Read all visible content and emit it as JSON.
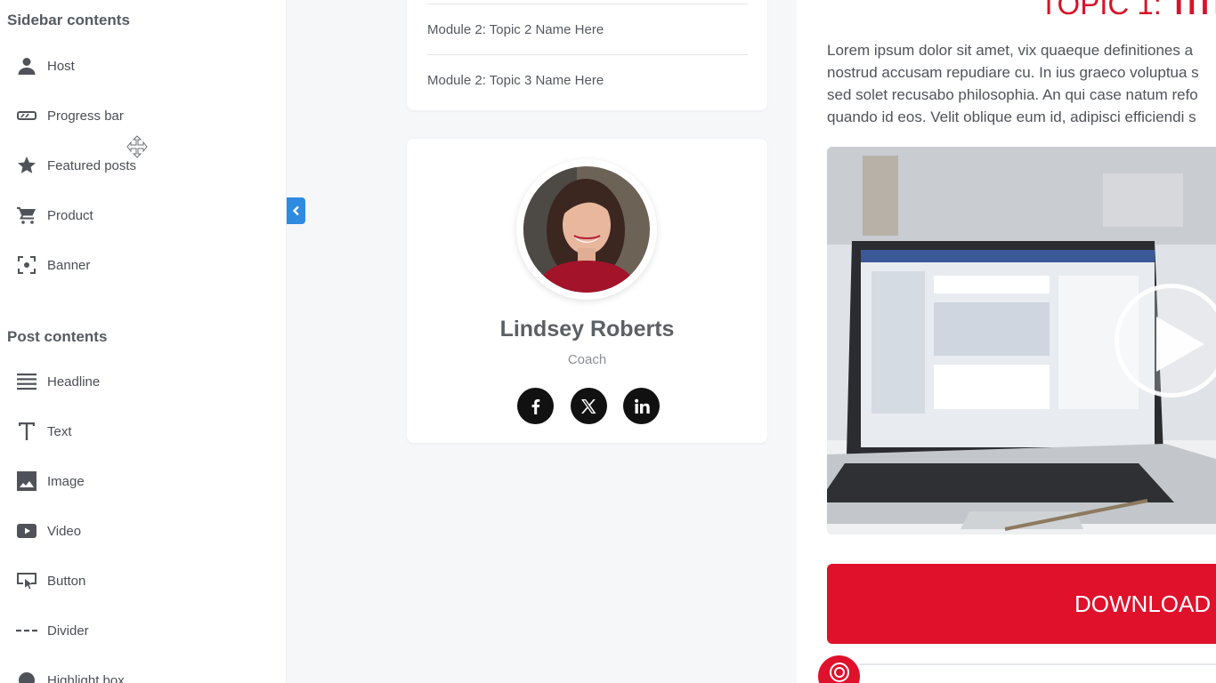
{
  "sidebar": {
    "section1_title": "Sidebar contents",
    "section1_items": [
      {
        "label": "Host",
        "icon": "person-icon"
      },
      {
        "label": "Progress bar",
        "icon": "progress-bar-icon"
      },
      {
        "label": "Featured posts",
        "icon": "star-icon"
      },
      {
        "label": "Product",
        "icon": "cart-icon"
      },
      {
        "label": "Banner",
        "icon": "banner-icon"
      }
    ],
    "section2_title": "Post contents",
    "section2_items": [
      {
        "label": "Headline",
        "icon": "headline-icon"
      },
      {
        "label": "Text",
        "icon": "text-icon"
      },
      {
        "label": "Image",
        "icon": "image-icon"
      },
      {
        "label": "Video",
        "icon": "video-icon"
      },
      {
        "label": "Button",
        "icon": "button-icon"
      },
      {
        "label": "Divider",
        "icon": "divider-icon"
      },
      {
        "label": "Highlight box",
        "icon": "highlight-box-icon"
      }
    ]
  },
  "topics": [
    "Module 2: Topic 2 Name Here",
    "Module 2: Topic 3 Name Here"
  ],
  "host": {
    "name": "Lindsey Roberts",
    "role": "Coach",
    "socials": [
      "facebook-icon",
      "x-icon",
      "linkedin-icon"
    ]
  },
  "preview": {
    "title_prefix": "TOPIC 1: ",
    "title_bold": "TITLE",
    "body": "Lorem ipsum dolor sit amet, vix quaeque definitiones a\nnostrud accusam repudiare cu. In ius graeco voluptua s\nsed solet recusabo philosophia. An qui case natum refo\nquando id eos. Velit oblique eum id, adipisci efficiendi s",
    "download_label": "DOWNLOAD I"
  },
  "colors": {
    "accent_red": "#e0112b",
    "collapse_blue": "#2f8be0"
  }
}
